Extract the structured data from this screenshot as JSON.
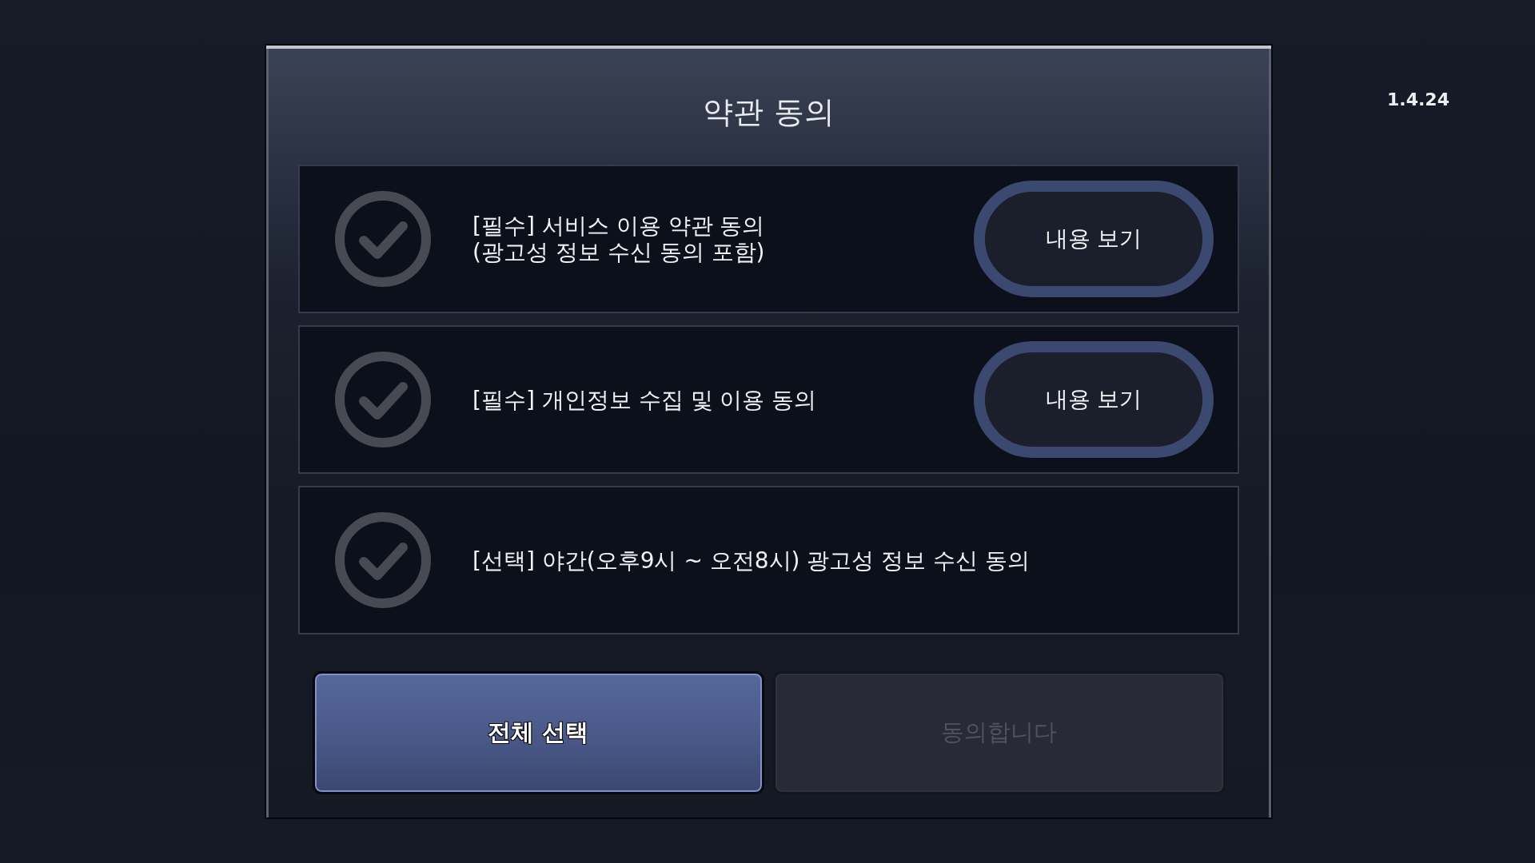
{
  "dialog": {
    "title": "약관 동의"
  },
  "terms": [
    {
      "text": "[필수] 서비스 이용 약관 동의\n(광고성 정보 수신 동의 포함)",
      "checked": false,
      "view_button": "내용 보기"
    },
    {
      "text": "[필수] 개인정보 수집 및 이용 동의",
      "checked": false,
      "view_button": "내용 보기"
    },
    {
      "text": "[선택] 야간(오후9시 ~ 오전8시) 광고성 정보 수신 동의",
      "checked": false
    }
  ],
  "actions": [
    {
      "label": "전체 선택",
      "disabled": false
    },
    {
      "label": "동의합니다",
      "disabled": true
    }
  ],
  "version": "1.4.24"
}
